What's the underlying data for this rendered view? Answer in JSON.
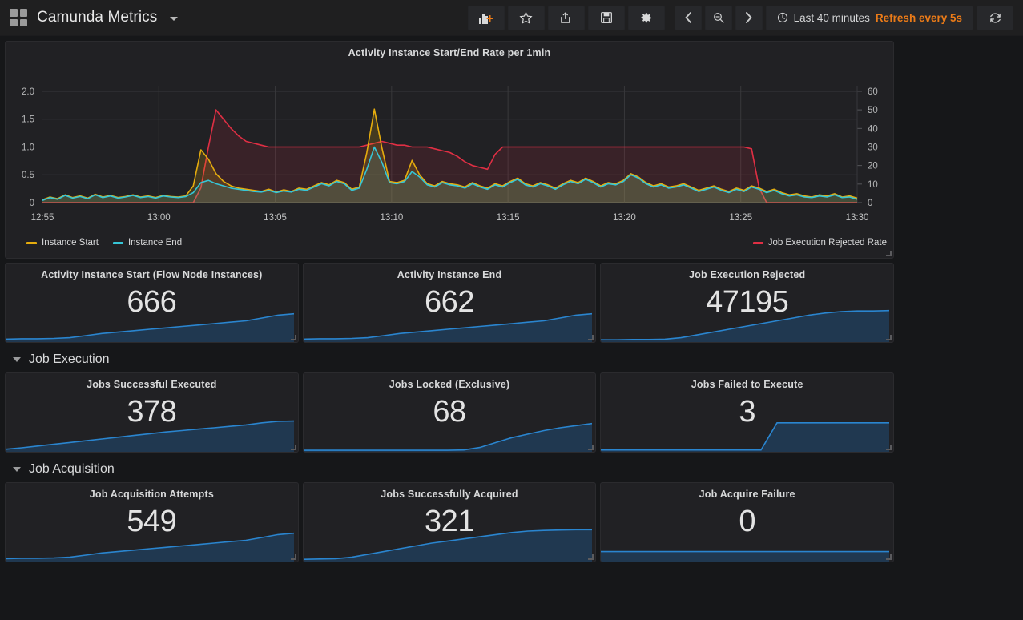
{
  "navbar": {
    "logo_icon": "grid-logo-icon",
    "dashboard_title": "Camunda Metrics",
    "caret_icon": "chevron-down-icon",
    "buttons": [
      {
        "name": "add-panel-button",
        "icon": "add-panel-icon",
        "label": ""
      },
      {
        "name": "star-dashboard-button",
        "icon": "star-icon",
        "label": ""
      },
      {
        "name": "share-dashboard-button",
        "icon": "share-icon",
        "label": ""
      },
      {
        "name": "save-dashboard-button",
        "icon": "save-floppy-icon",
        "label": ""
      },
      {
        "name": "dashboard-settings-button",
        "icon": "gear-icon",
        "label": ""
      }
    ],
    "time_nav": [
      {
        "name": "time-shift-back-button",
        "icon": "chevron-left-icon"
      },
      {
        "name": "zoom-out-time-button",
        "icon": "magnifier-minus-icon"
      },
      {
        "name": "time-shift-forward-button",
        "icon": "chevron-right-icon"
      }
    ],
    "timepicker": {
      "clock_icon": "clock-icon",
      "range_label": "Last 40 minutes",
      "refresh_label": "Refresh every 5s",
      "refresh_color": "#eb7b18"
    },
    "refresh_button": {
      "name": "refresh-button",
      "icon": "refresh-circular-arrows-icon"
    }
  },
  "graph_panel": {
    "title": "Activity Instance Start/End Rate per 1min",
    "legend": [
      {
        "label": "Instance Start",
        "color": "#e5ac0e"
      },
      {
        "label": "Instance End",
        "color": "#36c5d6"
      }
    ],
    "legend_right": [
      {
        "label": "Job Execution Rejected Rate",
        "color": "#e02f44"
      }
    ]
  },
  "rows": [
    {
      "title": "Job Execution",
      "chevron": "chevron-down-icon"
    },
    {
      "title": "Job Acquisition",
      "chevron": "chevron-down-icon"
    }
  ],
  "stat_rows": [
    {
      "panels": [
        {
          "title": "Activity Instance Start (Flow Node Instances)",
          "value": "666",
          "spark": "gentle-rise"
        },
        {
          "title": "Activity Instance End",
          "value": "662",
          "spark": "gentle-rise"
        },
        {
          "title": "Job Execution Rejected",
          "value": "47195",
          "spark": "late-ramp"
        }
      ]
    },
    {
      "panels": [
        {
          "title": "Jobs Successful Executed",
          "value": "378",
          "spark": "steady-rise"
        },
        {
          "title": "Jobs Locked (Exclusive)",
          "value": "68",
          "spark": "tail-rise"
        },
        {
          "title": "Jobs Failed to Execute",
          "value": "3",
          "spark": "step-up"
        }
      ]
    },
    {
      "panels": [
        {
          "title": "Job Acquisition Attempts",
          "value": "549",
          "spark": "gentle-rise"
        },
        {
          "title": "Jobs Successfully Acquired",
          "value": "321",
          "spark": "s-curve"
        },
        {
          "title": "Job Acquire Failure",
          "value": "0",
          "spark": "flat"
        }
      ]
    }
  ],
  "chart_data": {
    "type": "area",
    "title": "Activity Instance Start/End Rate per 1min",
    "xlabel": "",
    "ylabel": "",
    "grid": true,
    "legend_position": "bottom",
    "x": [
      "12:55",
      "13:00",
      "13:05",
      "13:10",
      "13:15",
      "13:20",
      "13:25",
      "13:30"
    ],
    "x_tick_labels": [
      "12:55",
      "13:00",
      "13:05",
      "13:10",
      "13:15",
      "13:20",
      "13:25",
      "13:30"
    ],
    "left_axis": {
      "ticks": [
        0,
        0.5,
        1.0,
        1.5,
        2.0
      ],
      "ylim": [
        0,
        2.1
      ],
      "tick_labels": [
        "0",
        "0.5",
        "1.0",
        "1.5",
        "2.0"
      ]
    },
    "right_axis": {
      "ticks": [
        0,
        10,
        20,
        30,
        40,
        50,
        60
      ],
      "ylim": [
        0,
        63
      ],
      "tick_labels": [
        "0",
        "10",
        "20",
        "30",
        "40",
        "50",
        "60"
      ]
    },
    "series": [
      {
        "name": "Instance Start",
        "color": "#e5ac0e",
        "axis": "left",
        "values": [
          0.05,
          0.1,
          0.07,
          0.14,
          0.09,
          0.12,
          0.08,
          0.15,
          0.1,
          0.13,
          0.09,
          0.11,
          0.14,
          0.1,
          0.12,
          0.09,
          0.13,
          0.11,
          0.1,
          0.12,
          0.3,
          0.95,
          0.78,
          0.52,
          0.38,
          0.3,
          0.26,
          0.24,
          0.22,
          0.2,
          0.24,
          0.19,
          0.23,
          0.2,
          0.26,
          0.24,
          0.3,
          0.36,
          0.32,
          0.4,
          0.36,
          0.24,
          0.28,
          0.9,
          1.68,
          0.98,
          0.38,
          0.36,
          0.4,
          0.76,
          0.5,
          0.34,
          0.3,
          0.38,
          0.34,
          0.32,
          0.28,
          0.36,
          0.3,
          0.26,
          0.34,
          0.3,
          0.38,
          0.44,
          0.34,
          0.3,
          0.36,
          0.32,
          0.26,
          0.34,
          0.4,
          0.36,
          0.44,
          0.38,
          0.3,
          0.36,
          0.34,
          0.4,
          0.52,
          0.46,
          0.36,
          0.3,
          0.34,
          0.28,
          0.3,
          0.34,
          0.28,
          0.22,
          0.26,
          0.3,
          0.24,
          0.2,
          0.26,
          0.22,
          0.3,
          0.26,
          0.2,
          0.24,
          0.18,
          0.14,
          0.16,
          0.12,
          0.1,
          0.14,
          0.12,
          0.16,
          0.1,
          0.12,
          0.08
        ]
      },
      {
        "name": "Instance End",
        "color": "#36c5d6",
        "axis": "left",
        "values": [
          0.04,
          0.09,
          0.06,
          0.13,
          0.08,
          0.11,
          0.07,
          0.14,
          0.09,
          0.12,
          0.08,
          0.1,
          0.13,
          0.09,
          0.11,
          0.08,
          0.12,
          0.1,
          0.09,
          0.11,
          0.18,
          0.36,
          0.4,
          0.34,
          0.3,
          0.26,
          0.24,
          0.22,
          0.2,
          0.19,
          0.22,
          0.18,
          0.21,
          0.19,
          0.24,
          0.22,
          0.28,
          0.34,
          0.3,
          0.38,
          0.34,
          0.22,
          0.26,
          0.6,
          1.0,
          0.72,
          0.36,
          0.34,
          0.38,
          0.56,
          0.46,
          0.32,
          0.28,
          0.36,
          0.32,
          0.3,
          0.26,
          0.34,
          0.28,
          0.24,
          0.32,
          0.28,
          0.36,
          0.42,
          0.32,
          0.28,
          0.34,
          0.3,
          0.24,
          0.32,
          0.38,
          0.34,
          0.42,
          0.36,
          0.28,
          0.34,
          0.32,
          0.38,
          0.5,
          0.44,
          0.34,
          0.28,
          0.32,
          0.26,
          0.28,
          0.32,
          0.26,
          0.2,
          0.24,
          0.28,
          0.22,
          0.18,
          0.24,
          0.2,
          0.28,
          0.24,
          0.18,
          0.22,
          0.16,
          0.12,
          0.14,
          0.1,
          0.09,
          0.12,
          0.1,
          0.14,
          0.09,
          0.1,
          0.06
        ]
      },
      {
        "name": "Job Execution Rejected Rate",
        "color": "#e02f44",
        "axis": "right",
        "values": [
          0,
          0,
          0,
          0,
          0,
          0,
          0,
          0,
          0,
          0,
          0,
          0,
          0,
          0,
          0,
          0,
          0,
          0,
          0,
          0,
          0,
          8,
          30,
          50,
          45,
          40,
          36,
          33,
          32,
          31,
          30,
          30,
          30,
          30,
          30,
          30,
          30,
          30,
          30,
          30,
          30,
          30,
          30,
          31,
          32,
          33,
          32,
          31,
          31,
          30,
          30,
          30,
          29,
          28,
          27,
          25,
          22,
          20,
          19,
          18,
          26,
          30,
          30,
          30,
          30,
          30,
          30,
          30,
          30,
          30,
          30,
          30,
          30,
          30,
          30,
          30,
          30,
          30,
          30,
          30,
          30,
          30,
          30,
          30,
          30,
          30,
          30,
          30,
          30,
          30,
          30,
          30,
          30,
          30,
          29,
          8,
          0,
          0,
          0,
          0,
          0,
          0,
          0,
          0,
          0,
          0,
          0,
          0,
          0
        ]
      }
    ]
  }
}
